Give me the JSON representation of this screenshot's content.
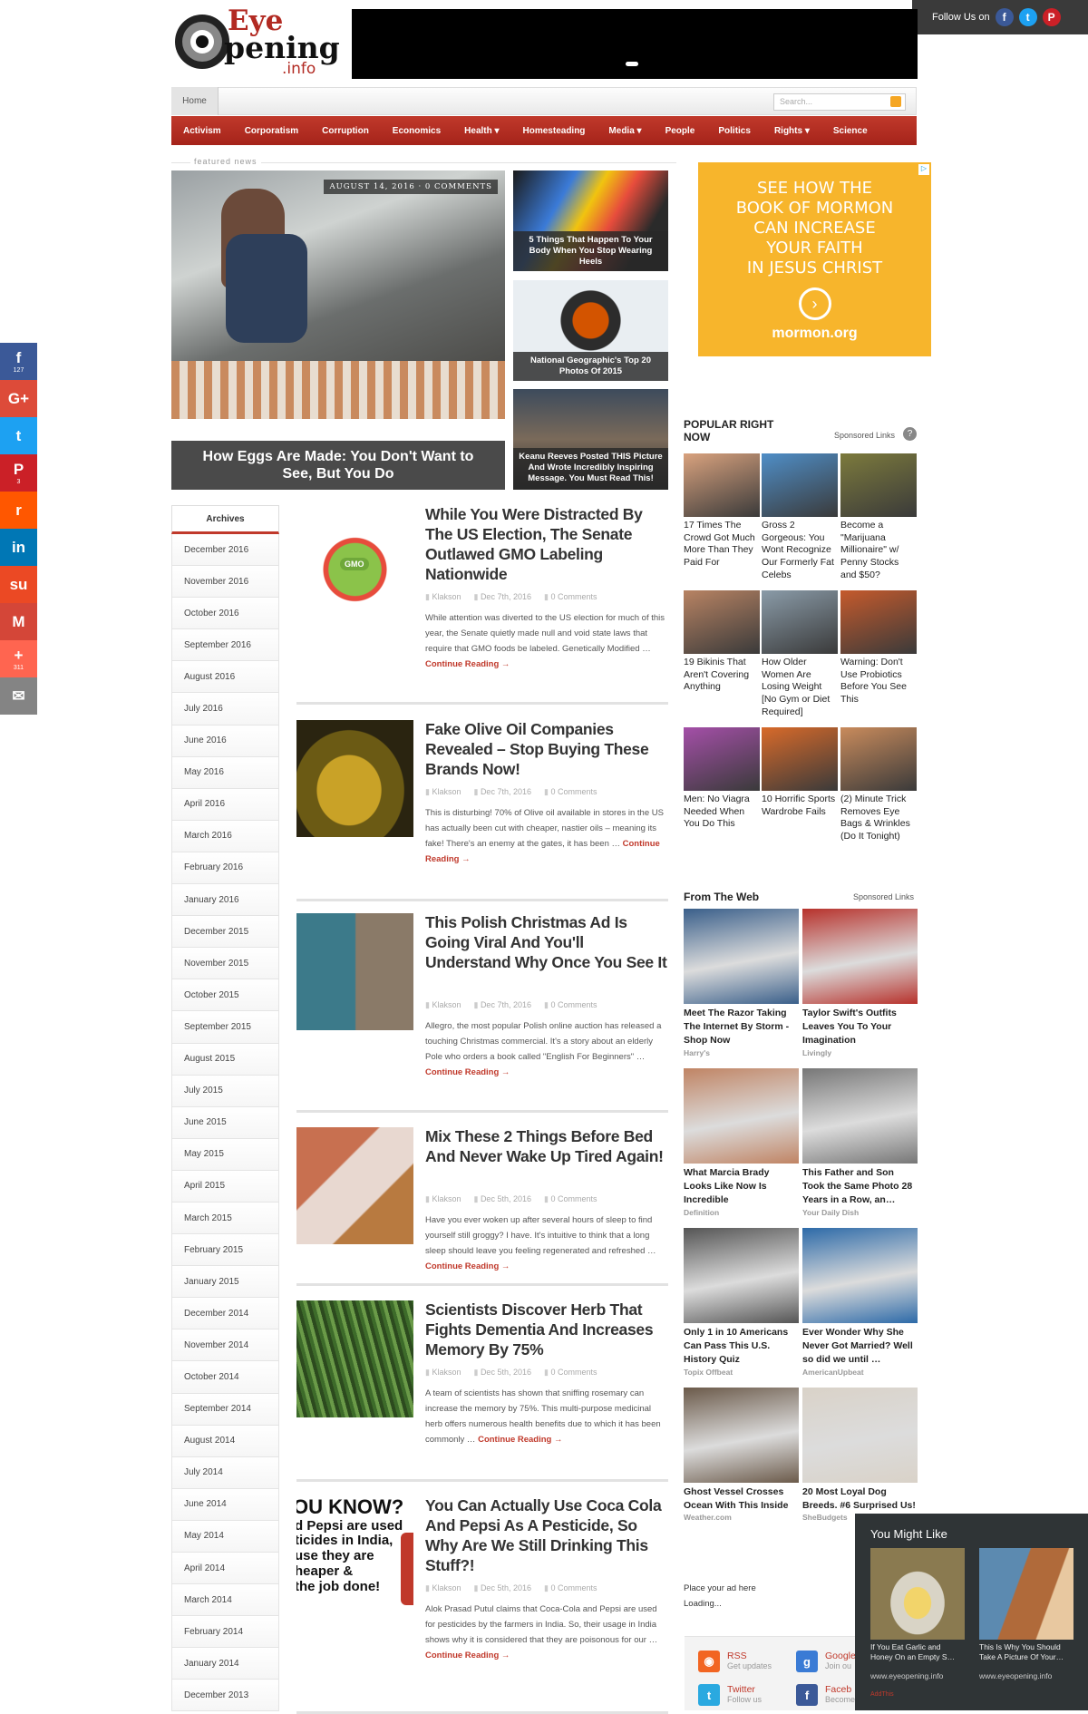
{
  "follow": {
    "label": "Follow Us on"
  },
  "share": [
    {
      "icon": "facebook-icon",
      "glyph": "f",
      "color": "#3b5998",
      "count": "127"
    },
    {
      "icon": "google-plus-icon",
      "glyph": "G+",
      "color": "#dd4b39",
      "count": ""
    },
    {
      "icon": "twitter-icon",
      "glyph": "t",
      "color": "#1da1f2",
      "count": ""
    },
    {
      "icon": "pinterest-icon",
      "glyph": "P",
      "color": "#cb2027",
      "count": "3"
    },
    {
      "icon": "reddit-icon",
      "glyph": "r",
      "color": "#ff5700",
      "count": ""
    },
    {
      "icon": "linkedin-icon",
      "glyph": "in",
      "color": "#0077b5",
      "count": ""
    },
    {
      "icon": "stumbleupon-icon",
      "glyph": "su",
      "color": "#eb4924",
      "count": ""
    },
    {
      "icon": "gmail-icon",
      "glyph": "M",
      "color": "#d44638",
      "count": ""
    },
    {
      "icon": "addthis-plus-icon",
      "glyph": "+",
      "color": "#ff6550",
      "count": "311"
    },
    {
      "icon": "email-icon",
      "glyph": "✉",
      "color": "#848484",
      "count": ""
    }
  ],
  "logo": {
    "line1": "Eye",
    "line2": "pening",
    "line3": ".info"
  },
  "nav": {
    "home": "Home",
    "search_placeholder": "Search..."
  },
  "categories": [
    "Activism",
    "Corporatism",
    "Corruption",
    "Economics",
    "Health ▾",
    "Homesteading",
    "Media ▾",
    "People",
    "Politics",
    "Rights ▾",
    "Science"
  ],
  "featured": {
    "section": "featured news",
    "main_meta": "AUGUST 14, 2016 · 0 COMMENTS",
    "main_title": "How Eggs Are Made: You Don't Want to See, But You Do",
    "side": [
      "5 Things That Happen To Your Body When You Stop Wearing Heels",
      "National Geographic's Top 20 Photos Of 2015",
      "Keanu Reeves Posted THIS Picture And Wrote Incredibly Inspiring Message. You Must Read This!"
    ]
  },
  "ad": {
    "line1": "SEE HOW THE",
    "line2": "BOOK OF MORMON",
    "line3": "CAN INCREASE",
    "line4": "YOUR FAITH",
    "line5": "IN JESUS CHRIST",
    "url": "mormon.org"
  },
  "archives": {
    "title": "Archives",
    "items": [
      "December 2016",
      "November 2016",
      "October 2016",
      "September 2016",
      "August 2016",
      "July 2016",
      "June 2016",
      "May 2016",
      "April 2016",
      "March 2016",
      "February 2016",
      "January 2016",
      "December 2015",
      "November 2015",
      "October 2015",
      "September 2015",
      "August 2015",
      "July 2015",
      "June 2015",
      "May 2015",
      "April 2015",
      "March 2015",
      "February 2015",
      "January 2015",
      "December 2014",
      "November 2014",
      "October 2014",
      "September 2014",
      "August 2014",
      "July 2014",
      "June 2014",
      "May 2014",
      "April 2014",
      "March 2014",
      "February 2014",
      "January 2014",
      "December 2013"
    ]
  },
  "posts": [
    {
      "title": "While You Were Distracted By The US Election, The Senate Outlawed GMO Labeling Nationwide",
      "author": "Klakson",
      "date": "Dec 7th, 2016",
      "comments": "0 Comments",
      "excerpt": "While attention was diverted to the US election for much of this year, the Senate quietly made null and void state laws that require that GMO foods be labeled. Genetically Modified …",
      "more": "Continue Reading →",
      "img_text": "GMO"
    },
    {
      "title": "Fake Olive Oil Companies Revealed – Stop Buying These Brands Now!",
      "author": "Klakson",
      "date": "Dec 7th, 2016",
      "comments": "0 Comments",
      "excerpt": "This is disturbing! 70% of Olive oil available in stores in the US has actually been cut with cheaper, nastier oils – meaning its fake! There's an enemy at the gates, it has been …",
      "more": "Continue Reading →"
    },
    {
      "title": "This Polish Christmas Ad Is Going Viral And You'll Understand Why Once You See It",
      "author": "Klakson",
      "date": "Dec 7th, 2016",
      "comments": "0 Comments",
      "excerpt": "Allegro, the most popular Polish online auction has released a touching Christmas commercial. It's a story about an elderly Pole who orders a book called \"English For Beginners\" …",
      "more": "Continue Reading →"
    },
    {
      "title": "Mix These 2 Things Before Bed And Never Wake Up Tired Again!",
      "author": "Klakson",
      "date": "Dec 5th, 2016",
      "comments": "0 Comments",
      "excerpt": "Have you ever woken up after several hours of sleep to find yourself still groggy? I have. It's intuitive to think that a long sleep should leave you feeling regenerated and refreshed …",
      "more": "Continue Reading →"
    },
    {
      "title": "Scientists Discover Herb That Fights Dementia And Increases Memory By 75%",
      "author": "Klakson",
      "date": "Dec 5th, 2016",
      "comments": "0 Comments",
      "excerpt": "A team of scientists has shown that sniffing rosemary can increase the memory by 75%. This multi-purpose medicinal herb offers numerous health benefits due to which it has been commonly …",
      "more": "Continue Reading →"
    },
    {
      "title": "You Can Actually Use Coca Cola And Pepsi As A Pesticide, So Why Are We Still Drinking This Stuff?!",
      "author": "Klakson",
      "date": "Dec 5th, 2016",
      "comments": "0 Comments",
      "excerpt": "Alok Prasad Putul claims that Coca-Cola and Pepsi are used for pesticides by the farmers in India. So, their usage in India shows why it is considered that they are poisonous for our …",
      "more": "Continue Reading →",
      "img_lines": [
        "OU KNOW?",
        "d Pepsi are used",
        "ticides in India,",
        "use they are",
        "heaper &",
        "the job done!"
      ]
    }
  ],
  "popular": {
    "title": "POPULAR RIGHT NOW",
    "sponsored": "Sponsored Links",
    "help": "?",
    "items": [
      {
        "text": "17 Times The Crowd Got Much More Than They Paid For",
        "color": "#d9a27e"
      },
      {
        "text": "Gross 2 Gorgeous: You Wont Recognize Our Formerly Fat Celebs",
        "color": "#4f8ec7"
      },
      {
        "text": "Become a \"Marijuana Millionaire\" w/ Penny Stocks and $50?",
        "color": "#7c7a3c"
      },
      {
        "text": "19 Bikinis That Aren't Covering Anything",
        "color": "#b88363"
      },
      {
        "text": "How Older Women Are Losing Weight [No Gym or Diet Required]",
        "color": "#8a9ba8"
      },
      {
        "text": "Warning: Don't Use Probiotics Before You See This",
        "color": "#c55a2c"
      },
      {
        "text": "Men: No Viagra Needed When You Do This",
        "color": "#a44fa8"
      },
      {
        "text": "10 Horrific Sports Wardrobe Fails",
        "color": "#d86a2a"
      },
      {
        "text": "(2) Minute Trick Removes Eye Bags & Wrinkles (Do It Tonight)",
        "color": "#c98b5c"
      }
    ]
  },
  "fromweb": {
    "title": "From The Web",
    "sponsored": "Sponsored Links",
    "items": [
      {
        "text": "Meet The Razor Taking The Internet By Storm - Shop Now",
        "source": "Harry's",
        "color": "#3a5f8a"
      },
      {
        "text": "Taylor Swift's Outfits Leaves You To Your Imagination",
        "source": "Livingly",
        "color": "#b7322c"
      },
      {
        "text": "What Marcia Brady Looks Like Now Is Incredible",
        "source": "Definition",
        "color": "#c08464"
      },
      {
        "text": "This Father and Son Took the Same Photo 28 Years in a Row, an…",
        "source": "Your Daily Dish",
        "color": "#777777"
      },
      {
        "text": "Only 1 in 10 Americans Can Pass This U.S. History Quiz",
        "source": "Topix Offbeat",
        "color": "#555555"
      },
      {
        "text": "Ever Wonder Why She Never Got Married? Well so did we until …",
        "source": "AmericanUpbeat",
        "color": "#2d6aa8"
      },
      {
        "text": "Ghost Vessel Crosses Ocean With This Inside",
        "source": "Weather.com",
        "color": "#6b5a4a"
      },
      {
        "text": "20 Most Loyal Dog Breeds. #6 Surprised Us!",
        "source": "SheBudgets",
        "color": "#d9d2c8"
      }
    ]
  },
  "placead": {
    "line1": "Place your ad here",
    "line2": "Loading..."
  },
  "social": [
    {
      "icon": "rss-icon",
      "glyph": "◉",
      "color": "#f26522",
      "t1": "RSS",
      "t2": "Get updates"
    },
    {
      "icon": "google-icon",
      "glyph": "g",
      "color": "#3a7bd5",
      "t1": "Google",
      "t2": "Join ou"
    },
    {
      "icon": "twitter-icon",
      "glyph": "t",
      "color": "#2aa9e0",
      "t1": "Twitter",
      "t2": "Follow us"
    },
    {
      "icon": "facebook-icon",
      "glyph": "f",
      "color": "#3b5998",
      "t1": "Faceb",
      "t2": "Become"
    }
  ],
  "youmightlike": {
    "title": "You Might Like",
    "items": [
      {
        "text": "If You Eat Garlic and Honey On an Empty S…",
        "domain": "www.eyeopening.info",
        "color": "#8a7a50"
      },
      {
        "text": "This Is Why You Should Take A Picture Of Your…",
        "domain": "www.eyeopening.info",
        "color": "#b06a3a"
      }
    ],
    "addthis": "AddThis"
  }
}
